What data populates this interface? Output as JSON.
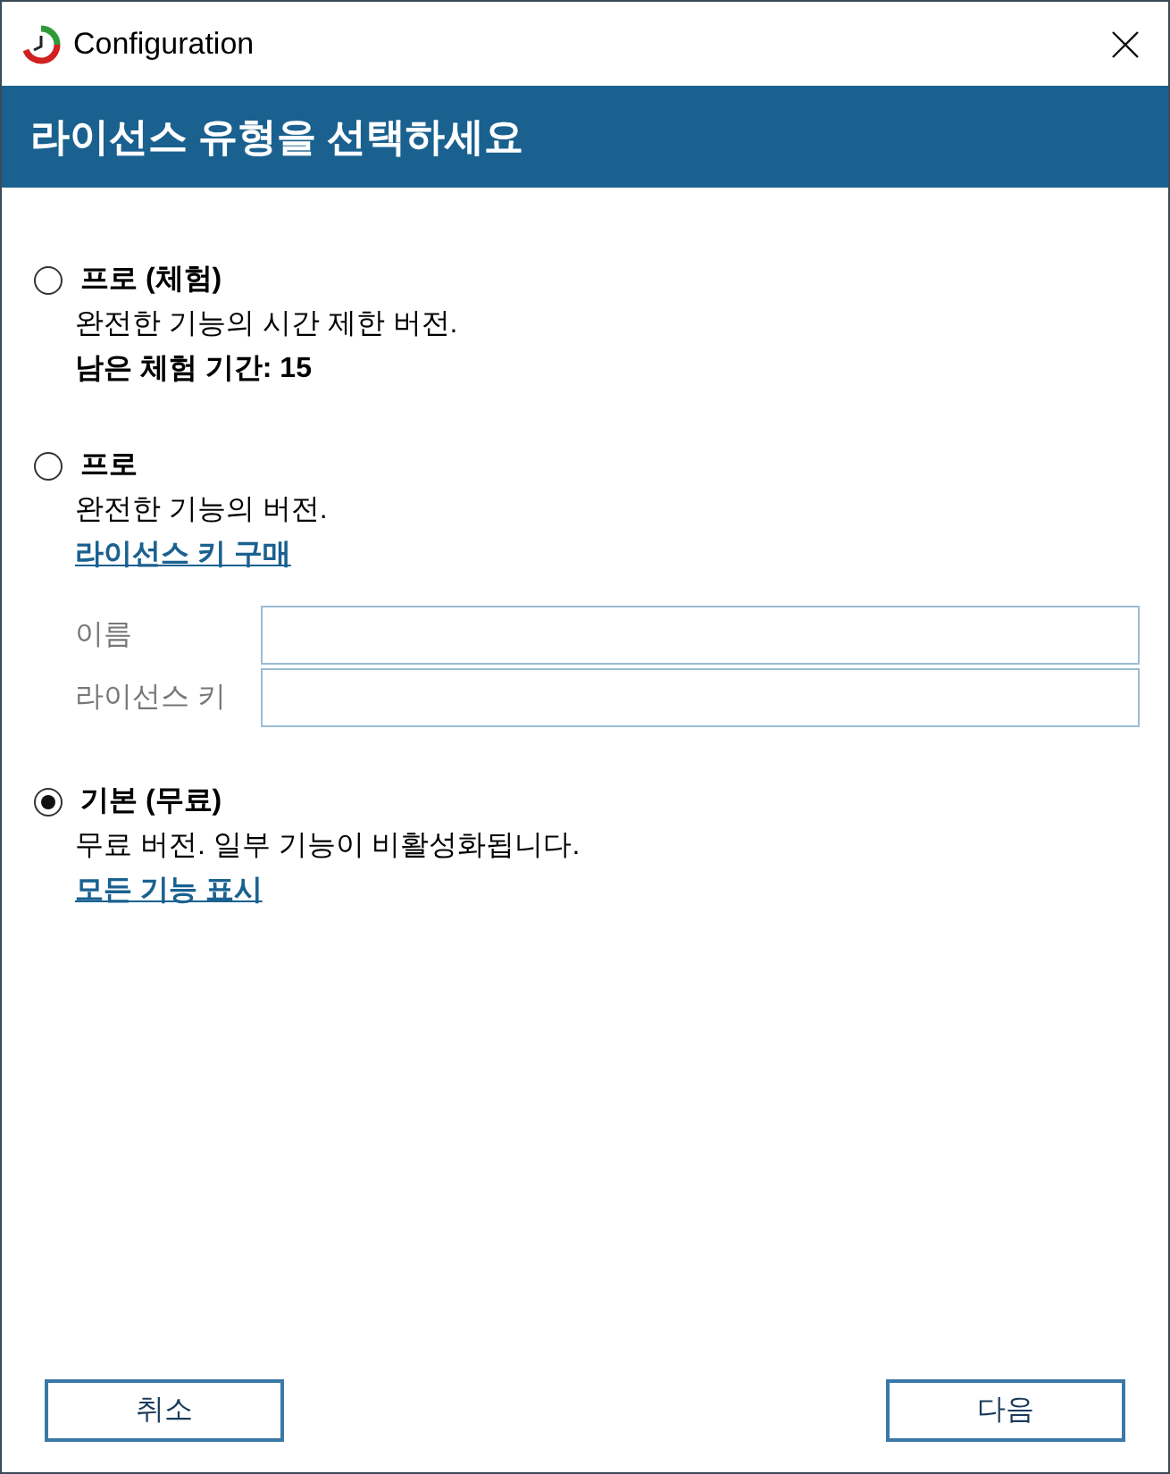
{
  "window": {
    "title": "Configuration"
  },
  "header": {
    "title": "라이선스 유형을 선택하세요"
  },
  "options": [
    {
      "title": "프로 (체험)",
      "selected": false,
      "description": "완전한 기능의 시간 제한 버전.",
      "note": "남은 체험 기간: 15"
    },
    {
      "title": "프로",
      "selected": false,
      "description": "완전한 기능의 버전.",
      "link": "라이선스 키 구매",
      "fields": [
        {
          "label": "이름"
        },
        {
          "label": "라이선스 키"
        }
      ]
    },
    {
      "title": "기본 (무료)",
      "selected": true,
      "description": "무료 버전. 일부 기능이 비활성화됩니다.",
      "link": "모든 기능 표시"
    }
  ],
  "buttons": [
    {
      "label": "취소"
    },
    {
      "label": "다음"
    }
  ]
}
